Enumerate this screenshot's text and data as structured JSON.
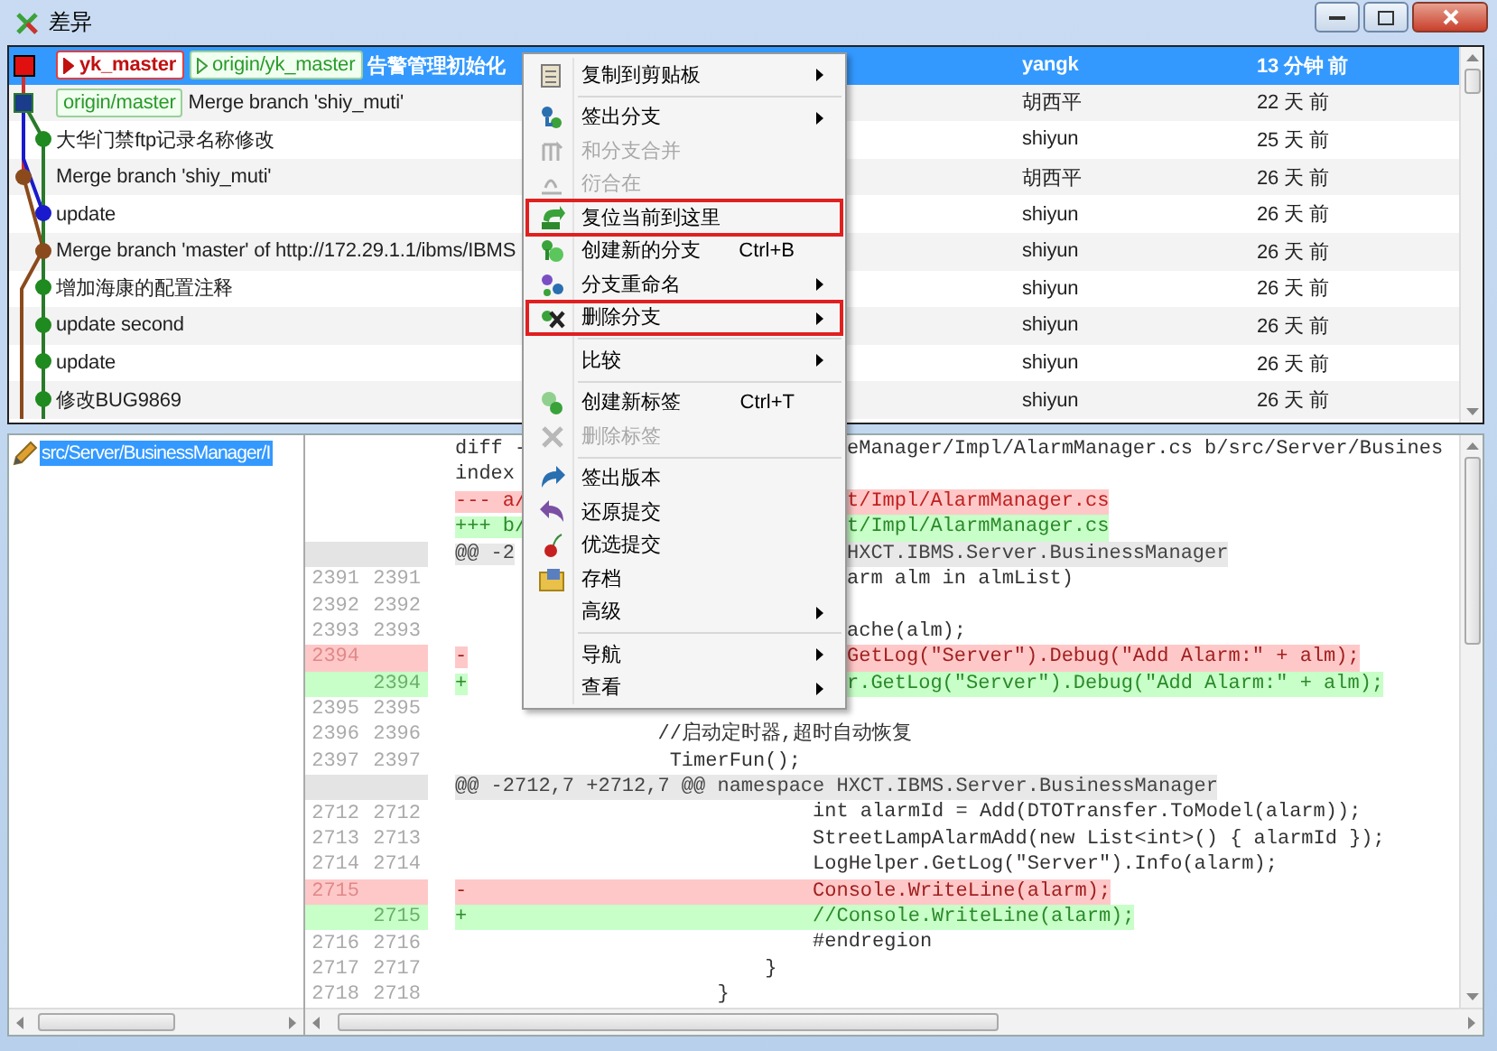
{
  "window": {
    "title": "差异"
  },
  "commits": [
    {
      "selected": true,
      "tags": [
        {
          "name": "yk_master",
          "kind": "local",
          "current": true
        },
        {
          "name": "origin/yk_master",
          "kind": "remote",
          "current": true
        }
      ],
      "message": "告警管理初始化",
      "author": "yangk",
      "date": "13 分钟 前"
    },
    {
      "selected": false,
      "tags": [
        {
          "name": "origin/master",
          "kind": "remote",
          "current": false
        }
      ],
      "message": "Merge branch 'shiy_muti'",
      "author": "胡西平",
      "date": "22 天 前"
    },
    {
      "selected": false,
      "message": "大华门禁ftp记录名称修改",
      "author": "shiyun",
      "date": "25 天 前"
    },
    {
      "selected": false,
      "message": "Merge branch 'shiy_muti'",
      "author": "胡西平",
      "date": "26 天 前"
    },
    {
      "selected": false,
      "message": "update",
      "author": "shiyun",
      "date": "26 天 前"
    },
    {
      "selected": false,
      "message": "Merge branch 'master' of http://172.29.1.1/ibms/IBMS",
      "author": "shiyun",
      "date": "26 天 前"
    },
    {
      "selected": false,
      "message": "增加海康的配置注释",
      "author": "shiyun",
      "date": "26 天 前"
    },
    {
      "selected": false,
      "message": "update second",
      "author": "shiyun",
      "date": "26 天 前"
    },
    {
      "selected": false,
      "message": "update",
      "author": "shiyun",
      "date": "26 天 前"
    },
    {
      "selected": false,
      "message": "修改BUG9869",
      "author": "shiyun",
      "date": "26 天 前"
    }
  ],
  "context_menu": [
    {
      "kind": "item",
      "label": "复制到剪贴板",
      "submenu": true,
      "disabled": false,
      "annotated": false
    },
    {
      "kind": "separator"
    },
    {
      "kind": "item",
      "label": "签出分支",
      "submenu": true,
      "disabled": false,
      "annotated": false
    },
    {
      "kind": "item",
      "label": "和分支合并",
      "submenu": false,
      "disabled": true,
      "annotated": false
    },
    {
      "kind": "item",
      "label": "衍合在",
      "submenu": false,
      "disabled": true,
      "annotated": false
    },
    {
      "kind": "item",
      "label": "复位当前到这里",
      "submenu": false,
      "disabled": false,
      "annotated": true
    },
    {
      "kind": "item",
      "label": "创建新的分支",
      "shortcut": "Ctrl+B",
      "submenu": false,
      "disabled": false,
      "annotated": false
    },
    {
      "kind": "item",
      "label": "分支重命名",
      "submenu": true,
      "disabled": false,
      "annotated": false
    },
    {
      "kind": "item",
      "label": "删除分支",
      "submenu": true,
      "disabled": false,
      "annotated": true
    },
    {
      "kind": "separator"
    },
    {
      "kind": "item",
      "label": "比较",
      "submenu": true,
      "disabled": false,
      "annotated": false
    },
    {
      "kind": "separator"
    },
    {
      "kind": "item",
      "label": "创建新标签",
      "shortcut": "Ctrl+T",
      "submenu": false,
      "disabled": false,
      "annotated": false
    },
    {
      "kind": "item",
      "label": "删除标签",
      "submenu": false,
      "disabled": true,
      "annotated": false
    },
    {
      "kind": "separator"
    },
    {
      "kind": "item",
      "label": "签出版本",
      "submenu": false,
      "disabled": false,
      "annotated": false
    },
    {
      "kind": "item",
      "label": "还原提交",
      "submenu": false,
      "disabled": false,
      "annotated": false
    },
    {
      "kind": "item",
      "label": "优选提交",
      "submenu": false,
      "disabled": false,
      "annotated": false
    },
    {
      "kind": "item",
      "label": "存档",
      "submenu": false,
      "disabled": false,
      "annotated": false
    },
    {
      "kind": "item",
      "label": "高级",
      "submenu": true,
      "disabled": false,
      "annotated": false
    },
    {
      "kind": "separator"
    },
    {
      "kind": "item",
      "label": "导航",
      "submenu": true,
      "disabled": false,
      "annotated": false
    },
    {
      "kind": "item",
      "label": "查看",
      "submenu": true,
      "disabled": false,
      "annotated": false
    }
  ],
  "files": [
    {
      "path": "src/Server/BusinessManager/I",
      "selected": true
    }
  ],
  "diff": [
    {
      "kind": "meta",
      "left": "diff -",
      "right": "eManager/Impl/AlarmManager.cs b/src/Server/Busines"
    },
    {
      "kind": "meta",
      "left": "index"
    },
    {
      "kind": "meta_del",
      "left": "--- a/",
      "right": "t/Impl/AlarmManager.cs"
    },
    {
      "kind": "meta_add",
      "left": "+++ b/",
      "right": "t/Impl/AlarmManager.cs"
    },
    {
      "kind": "hunk",
      "left": "@@ -2",
      "right": "HXCT.IBMS.Server.BusinessManager"
    },
    {
      "kind": "context",
      "old": "2391",
      "new": "2391",
      "right": "arm alm in almList)"
    },
    {
      "kind": "context",
      "old": "2392",
      "new": "2392"
    },
    {
      "kind": "context",
      "old": "2393",
      "new": "2393",
      "right": "ache(alm);"
    },
    {
      "kind": "del",
      "old": "2394",
      "left": "-",
      "right": "GetLog(\"Server\").Debug(\"Add Alarm:\" + alm);"
    },
    {
      "kind": "add",
      "new": "2394",
      "left": "+",
      "right": "r.GetLog(\"Server\").Debug(\"Add Alarm:\" + alm);"
    },
    {
      "kind": "context",
      "old": "2395",
      "new": "2395"
    },
    {
      "kind": "context",
      "old": "2396",
      "new": "2396",
      "code": "                 //启动定时器,超时自动恢复"
    },
    {
      "kind": "context",
      "old": "2397",
      "new": "2397",
      "code": "                  TimerFun();"
    },
    {
      "kind": "hunk",
      "code": "@@ -2712,7 +2712,7 @@ namespace HXCT.IBMS.Server.BusinessManager"
    },
    {
      "kind": "context",
      "old": "2712",
      "new": "2712",
      "code": "                              int alarmId = Add(DTOTransfer.ToModel(alarm));"
    },
    {
      "kind": "context",
      "old": "2713",
      "new": "2713",
      "code": "                              StreetLampAlarmAdd(new List<int>() { alarmId });"
    },
    {
      "kind": "context",
      "old": "2714",
      "new": "2714",
      "code": "                              LogHelper.GetLog(\"Server\").Info(alarm);"
    },
    {
      "kind": "del",
      "old": "2715",
      "code": "-                             Console.WriteLine(alarm);"
    },
    {
      "kind": "add",
      "new": "2715",
      "code": "+                             //Console.WriteLine(alarm);"
    },
    {
      "kind": "context",
      "old": "2716",
      "new": "2716",
      "code": "                              #endregion"
    },
    {
      "kind": "context",
      "old": "2717",
      "new": "2717",
      "code": "                          }"
    },
    {
      "kind": "context",
      "old": "2718",
      "new": "2718",
      "code": "                      }"
    }
  ]
}
